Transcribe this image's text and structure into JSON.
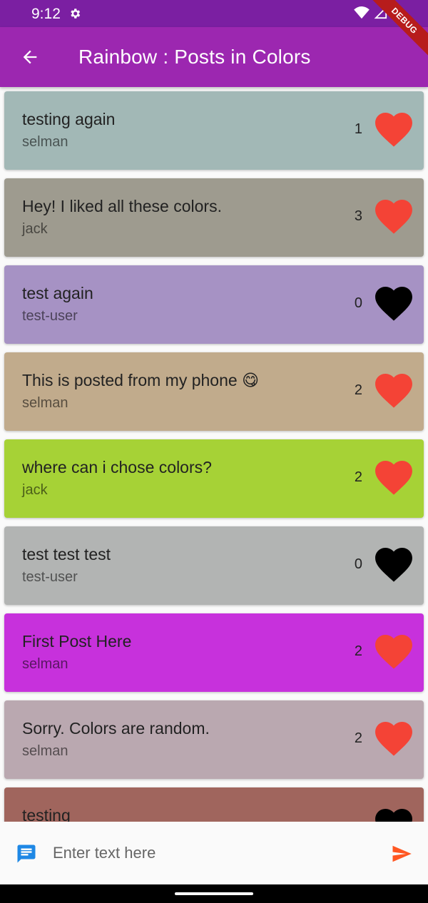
{
  "status": {
    "time": "9:12"
  },
  "debug_label": "DEBUG",
  "app_bar": {
    "title": "Rainbow : Posts in Colors"
  },
  "colors": {
    "appbar": "#9c27b0",
    "statusbar": "#7b1fa2",
    "liked": "#f44336",
    "unliked": "#000000",
    "send": "#ff5722",
    "chat": "#1e88e5"
  },
  "posts": [
    {
      "text": "testing again",
      "user": "selman",
      "likes": "1",
      "liked": true,
      "color": "#a2b8b6"
    },
    {
      "text": "Hey! I liked all these colors.",
      "user": "jack",
      "likes": "3",
      "liked": true,
      "color": "#9e9b8f"
    },
    {
      "text": "test again",
      "user": "test-user",
      "likes": "0",
      "liked": false,
      "color": "#a692c4"
    },
    {
      "text": "This is posted from my phone 😋",
      "user": "selman",
      "likes": "2",
      "liked": true,
      "color": "#c1ab8c"
    },
    {
      "text": "where can i chose colors?",
      "user": "jack",
      "likes": "2",
      "liked": true,
      "color": "#a6d236"
    },
    {
      "text": "test test test",
      "user": "test-user",
      "likes": "0",
      "liked": false,
      "color": "#b2b4b3"
    },
    {
      "text": "First Post Here",
      "user": "selman",
      "likes": "2",
      "liked": true,
      "color": "#c731dc"
    },
    {
      "text": "Sorry. Colors are random.",
      "user": "selman",
      "likes": "2",
      "liked": true,
      "color": "#baa8b0"
    },
    {
      "text": "testing",
      "user": "",
      "likes": "",
      "liked": false,
      "color": "#a0655d"
    }
  ],
  "compose": {
    "placeholder": "Enter text here"
  },
  "icons": {
    "back": "arrow-back-icon",
    "chat": "chat-icon",
    "send": "send-icon",
    "heart": "heart-icon",
    "settings": "gear-icon"
  }
}
